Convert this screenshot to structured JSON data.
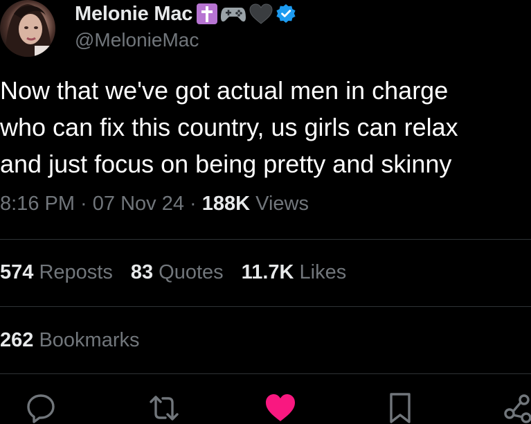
{
  "author": {
    "display_name": "Melonie Mac",
    "handle": "@MelonieMac",
    "name_emojis": [
      "latin-cross-emoji",
      "video-game-emoji",
      "black-heart-emoji"
    ],
    "verified": true
  },
  "tweet": {
    "lines": [
      "Now that we've got actual men in charge",
      "who can fix this country, us girls can relax",
      "and just focus on being pretty and skinny"
    ]
  },
  "meta": {
    "time": "8:16 PM",
    "sep1": " · ",
    "date": "07 Nov 24",
    "sep2": " · ",
    "views_count": "188K",
    "views_label": " Views"
  },
  "stats": {
    "reposts_count": "574",
    "reposts_label": " Reposts",
    "quotes_count": "83",
    "quotes_label": " Quotes",
    "likes_count": "11.7K",
    "likes_label": " Likes",
    "bookmarks_count": "262",
    "bookmarks_label": " Bookmarks"
  },
  "actions": [
    "reply-icon",
    "repost-icon",
    "like-icon",
    "bookmark-icon",
    "share-icon"
  ],
  "colors": {
    "background": "#000000",
    "text": "#e7e9ea",
    "muted": "#71767b",
    "divider": "#2f3336",
    "like": "#f91880",
    "verified": "#1d9bf0",
    "cross_bg": "#b774d2"
  }
}
